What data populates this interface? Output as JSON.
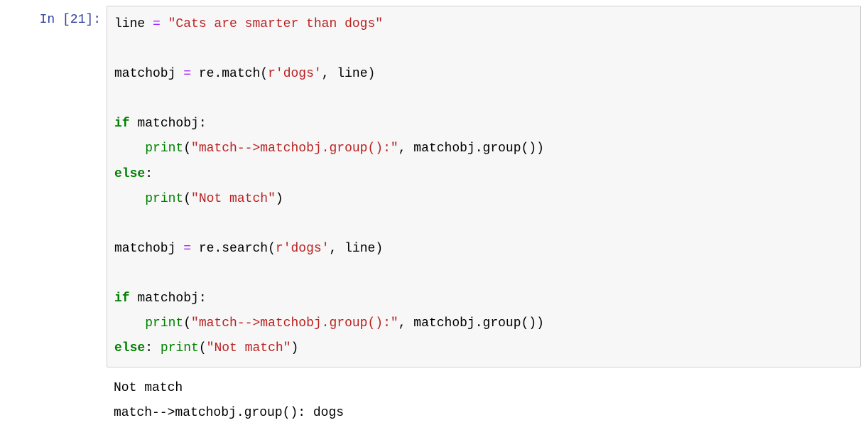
{
  "cell": {
    "prompt_label": "In  ",
    "prompt_open": "[",
    "prompt_number": "21",
    "prompt_close": "]:",
    "code": {
      "line1_var": "line",
      "line1_eq": " = ",
      "line1_str": "\"Cats are smarter than dogs\"",
      "line2_var": "matchobj",
      "line2_eq": " = ",
      "line2_mod": "re",
      "line2_dot": ".",
      "line2_func": "match",
      "line2_open": "(",
      "line2_rprefix": "r",
      "line2_rstr": "'dogs'",
      "line2_comma": ", line",
      "line2_close": ")",
      "line3_if": "if",
      "line3_cond": " matchobj:",
      "line4_indent": "    ",
      "line4_print": "print",
      "line4_open": "(",
      "line4_str": "\"match-->matchobj.group():\"",
      "line4_rest": ", matchobj.group())",
      "line5_else": "else",
      "line5_colon": ":",
      "line6_indent": "    ",
      "line6_print": "print",
      "line6_open": "(",
      "line6_str": "\"Not match\"",
      "line6_close": ")",
      "line7_var": "matchobj",
      "line7_eq": " = ",
      "line7_mod": "re",
      "line7_dot": ".",
      "line7_func": "search",
      "line7_open": "(",
      "line7_rprefix": "r",
      "line7_rstr": "'dogs'",
      "line7_comma": ", line",
      "line7_close": ")",
      "line8_if": "if",
      "line8_cond": " matchobj:",
      "line9_indent": "    ",
      "line9_print": "print",
      "line9_open": "(",
      "line9_str": "\"match-->matchobj.group():\"",
      "line9_rest": ", matchobj.group())",
      "line10_else": "else",
      "line10_colon": ": ",
      "line10_print": "print",
      "line10_open": "(",
      "line10_str": "\"Not match\"",
      "line10_close": ")"
    }
  },
  "output": {
    "line1": "Not match",
    "line2": "match-->matchobj.group(): dogs"
  }
}
